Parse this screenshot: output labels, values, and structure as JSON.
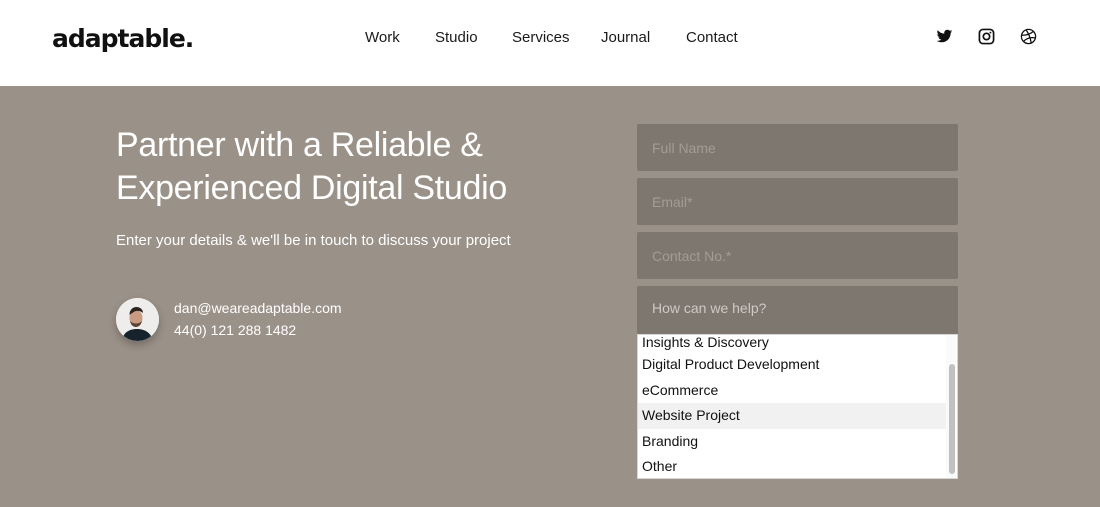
{
  "header": {
    "logo": "adaptable.",
    "nav": [
      {
        "label": "Work"
      },
      {
        "label": "Studio"
      },
      {
        "label": "Services"
      },
      {
        "label": "Journal"
      },
      {
        "label": "Contact"
      }
    ],
    "social": [
      {
        "icon": "twitter-icon"
      },
      {
        "icon": "instagram-icon"
      },
      {
        "icon": "dribbble-icon"
      }
    ]
  },
  "hero": {
    "title_line1": "Partner with a Reliable &",
    "title_line2": "Experienced Digital Studio",
    "subtitle": "Enter your details & we'll be in touch to discuss your project"
  },
  "contact": {
    "email": "dan@weareadaptable.com",
    "phone": "44(0) 121 288 1482"
  },
  "form": {
    "full_name": {
      "placeholder": "Full Name",
      "value": ""
    },
    "email": {
      "placeholder": "Email*",
      "value": ""
    },
    "contact_no": {
      "placeholder": "Contact No.*",
      "value": ""
    },
    "help_select": {
      "placeholder": "How can we help?",
      "options": [
        "Insights & Discovery",
        "Digital Product Development",
        "eCommerce",
        "Website Project",
        "Branding",
        "Other"
      ],
      "highlighted": "Website Project"
    }
  },
  "colors": {
    "background": "#9a9188",
    "field_bg": "#7e7770",
    "header_bg": "#ffffff"
  }
}
